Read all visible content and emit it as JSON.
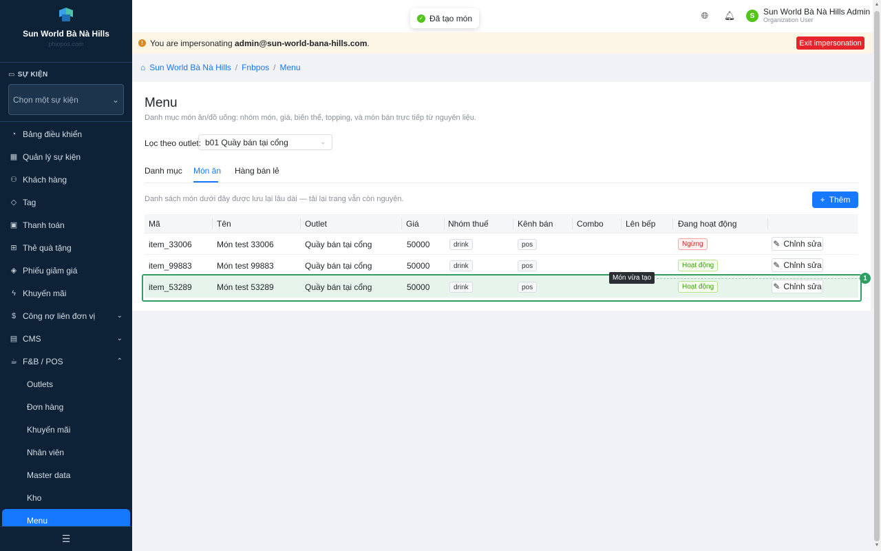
{
  "sidebar": {
    "brand_title": "Sun World Bà Nà Hills",
    "brand_sub": "phiopos.com",
    "section_label": "SỰ KIỆN",
    "event_select_placeholder": "Chọn một sự kiện",
    "items": [
      {
        "label": "Bảng điều khiển",
        "icon": "dashboard-icon"
      },
      {
        "label": "Quản lý sự kiện",
        "icon": "calendar-icon"
      },
      {
        "label": "Khách hàng",
        "icon": "users-icon"
      },
      {
        "label": "Tag",
        "icon": "tag-icon"
      },
      {
        "label": "Thanh toán",
        "icon": "payment-icon"
      },
      {
        "label": "Thẻ quà tặng",
        "icon": "gift-icon"
      },
      {
        "label": "Phiếu giảm giá",
        "icon": "coupon-icon"
      },
      {
        "label": "Khuyến mãi",
        "icon": "promotion-icon"
      },
      {
        "label": "Công nợ liên đơn vị",
        "icon": "debt-icon"
      },
      {
        "label": "CMS",
        "icon": "cms-icon"
      },
      {
        "label": "F&B / POS",
        "icon": "fnb-icon"
      }
    ],
    "fnb_sub_items": [
      "Outlets",
      "Đơn hàng",
      "Khuyến mãi",
      "Nhân viên",
      "Master data",
      "Kho",
      "Menu"
    ]
  },
  "topbar": {
    "toast": "Đã tạo món",
    "user_name": "Sun World Bà Nà Hills Admin",
    "user_role": "Organization User",
    "avatar_letter": "S"
  },
  "impersonation": {
    "prefix": "You are impersonating",
    "email": "admin@sun-world-bana-hills.com",
    "suffix": ".",
    "exit_label": "Exit impersonation"
  },
  "breadcrumb": {
    "home": "Sun World Bà Nà Hills",
    "section": "Fnbpos",
    "page": "Menu"
  },
  "main": {
    "title": "Menu",
    "subtitle": "Danh mục món ăn/đồ uống: nhóm món, giá, biến thể, topping, và món bán trực tiếp từ nguyên liệu.",
    "filter_label": "Lọc theo outlet:",
    "filter_value": "b01 Quầy bán tại cổng",
    "tabs": [
      "Danh mục",
      "Món ăn",
      "Hàng bán lẻ"
    ],
    "list_note": "Danh sách món dưới đây được lưu lại lâu dài — tải lại trang vẫn còn nguyên.",
    "add_label": "Thêm",
    "columns": [
      "Mã",
      "Tên",
      "Outlet",
      "Giá",
      "Nhóm thuế",
      "Kênh bán",
      "Combo",
      "Lên bếp",
      "Đang hoạt động"
    ],
    "rows": [
      {
        "code": "item_33006",
        "name": "Món test 33006",
        "outlet": "Quầy bán tại cổng",
        "price": "50000",
        "tax": "drink",
        "channel": "pos",
        "status": "Ngừng",
        "edit": "Chỉnh sửa"
      },
      {
        "code": "item_99883",
        "name": "Món test 99883",
        "outlet": "Quầy bán tại cổng",
        "price": "50000",
        "tax": "drink",
        "channel": "pos",
        "status": "Hoạt động",
        "edit": "Chỉnh sửa"
      },
      {
        "code": "item_53289",
        "name": "Món test 53289",
        "outlet": "Quầy bán tại cổng",
        "price": "50000",
        "tax": "drink",
        "channel": "pos",
        "status": "Hoạt động",
        "edit": "Chỉnh sửa"
      }
    ],
    "highlight_tooltip": "Món vừa tạo",
    "highlight_badge": "1"
  },
  "colors": {
    "sidebar_bg": "#0d2237",
    "accent": "#1677ff",
    "danger": "#e5242c",
    "success": "#2e9e62"
  }
}
